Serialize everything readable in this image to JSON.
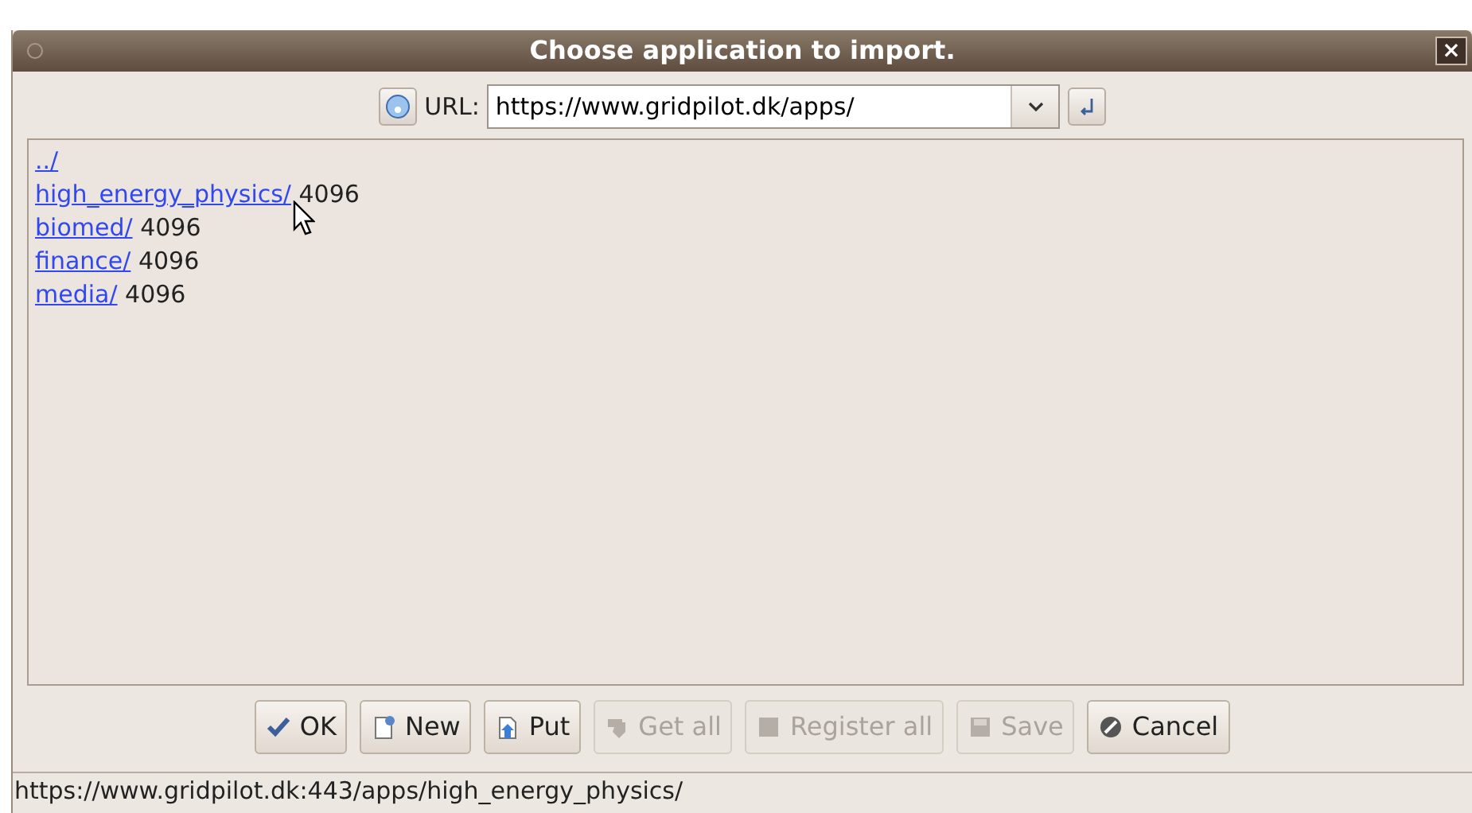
{
  "window": {
    "title": "Choose application to import.",
    "close": "×"
  },
  "toolbar": {
    "url_label": "URL:",
    "url": "https://www.gridpilot.dk/apps/"
  },
  "listing": [
    {
      "link": "../"
    },
    {
      "link": "high_energy_physics/",
      "size": "4096",
      "hovered": true
    },
    {
      "link": "biomed/",
      "size": "4096",
      "hovered": false
    },
    {
      "link": "finance/",
      "size": "4096",
      "hovered": false
    },
    {
      "link": "media/",
      "size": "4096",
      "hovered": false
    }
  ],
  "buttons": [
    {
      "kind": "ok",
      "label": "OK",
      "disabled": false
    },
    {
      "kind": "new",
      "label": "New",
      "disabled": false
    },
    {
      "kind": "put",
      "label": "Put",
      "disabled": false
    },
    {
      "kind": "get",
      "label": "Get all",
      "disabled": true
    },
    {
      "kind": "register",
      "label": "Register all",
      "disabled": true
    },
    {
      "kind": "save",
      "label": "Save",
      "disabled": true
    },
    {
      "kind": "cancel",
      "label": "Cancel",
      "disabled": false
    }
  ],
  "status_bar": "https://www.gridpilot.dk:443/apps/high_energy_physics/"
}
